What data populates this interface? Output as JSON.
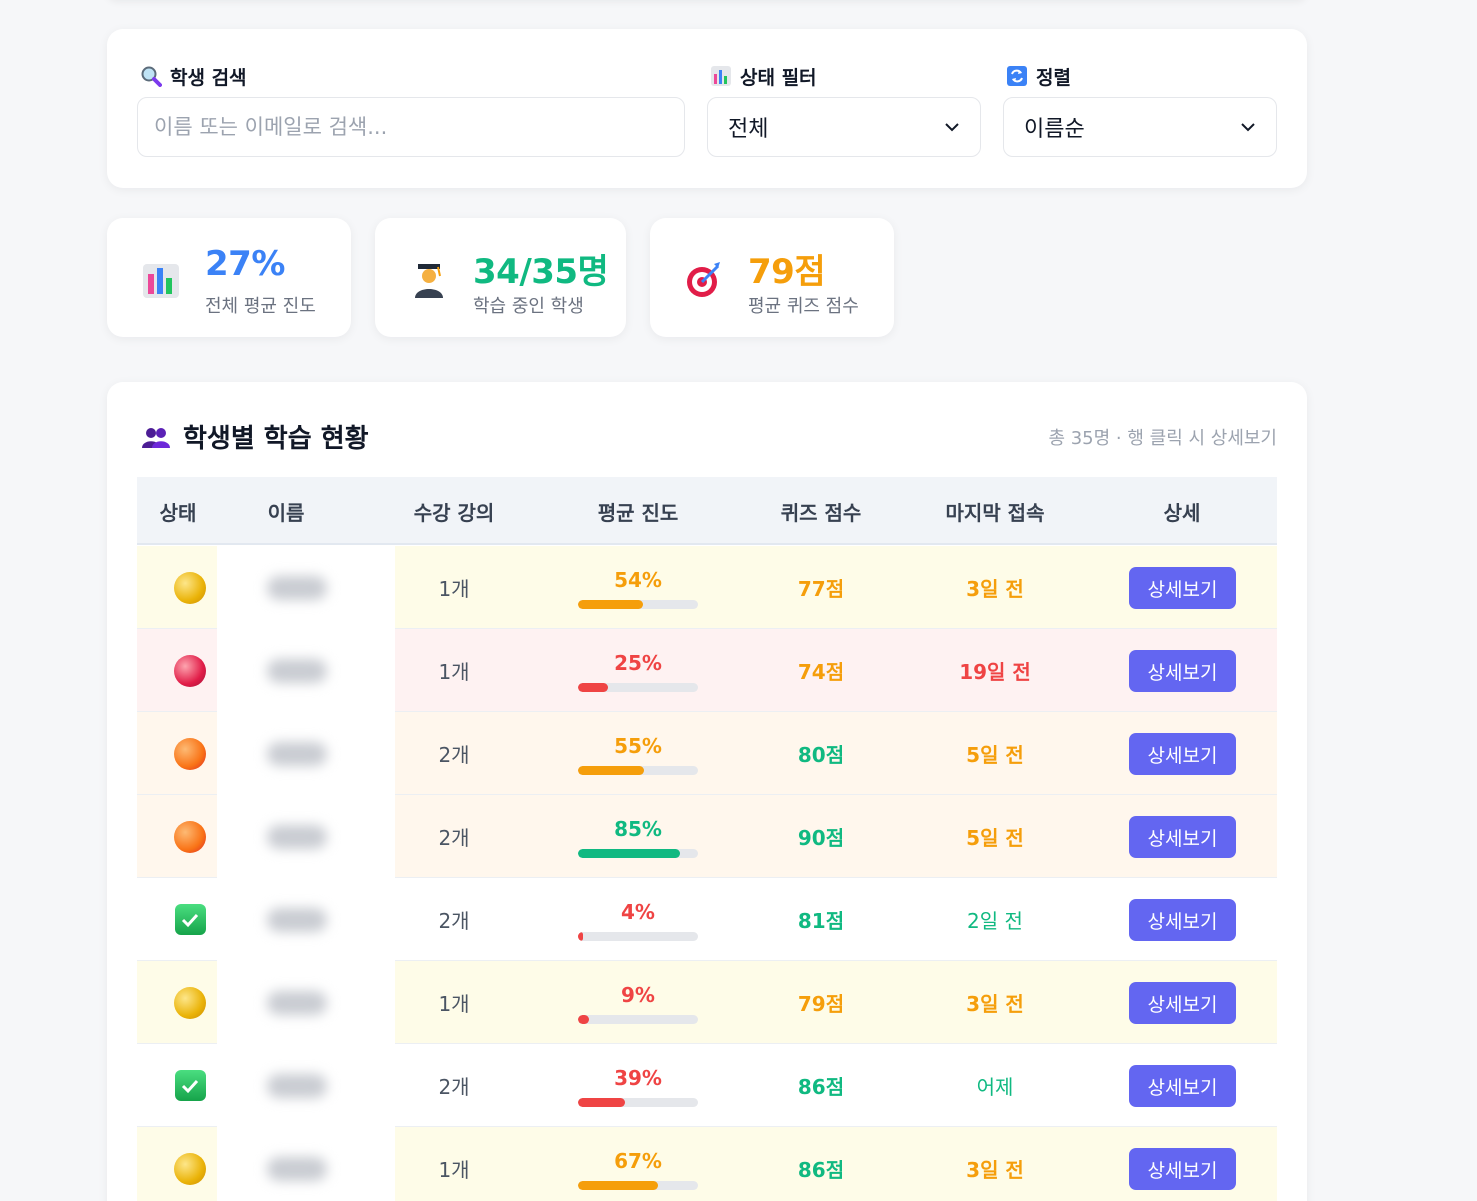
{
  "search": {
    "label": "학생 검색",
    "placeholder": "이름 또는 이메일로 검색..."
  },
  "status_filter": {
    "label": "상태 필터",
    "selected": "전체"
  },
  "sort": {
    "label": "정렬",
    "selected": "이름순"
  },
  "stats": [
    {
      "value": "27%",
      "label": "전체 평균 진도",
      "icon": "bar-chart-icon",
      "color": "#3b82f6"
    },
    {
      "value": "34/35명",
      "label": "학습 중인 학생",
      "icon": "student-icon",
      "color": "#10b981"
    },
    {
      "value": "79점",
      "label": "평균 퀴즈 점수",
      "icon": "target-icon",
      "color": "#f59e0b"
    }
  ],
  "table": {
    "title": "학생별 학습 현황",
    "meta": "총 35명 · 행 클릭 시 상세보기",
    "headers": [
      "상태",
      "이름",
      "수강 강의",
      "평균 진도",
      "퀴즈 점수",
      "마지막 접속",
      "상세"
    ],
    "button_label": "상세보기",
    "rows": [
      {
        "status": "yellow",
        "courses": "1개",
        "progress": 54,
        "progress_label": "54%",
        "score": "77점",
        "last": "3일 전",
        "bg": "#fefce8",
        "prog_color": "#f59e0b",
        "score_color": "#f59e0b",
        "last_color": "#f59e0b",
        "last_bold": true
      },
      {
        "status": "red",
        "courses": "1개",
        "progress": 25,
        "progress_label": "25%",
        "score": "74점",
        "last": "19일 전",
        "bg": "#fef2f2",
        "prog_color": "#ef4444",
        "score_color": "#f59e0b",
        "last_color": "#ef4444",
        "last_bold": true
      },
      {
        "status": "orange",
        "courses": "2개",
        "progress": 55,
        "progress_label": "55%",
        "score": "80점",
        "last": "5일 전",
        "bg": "#fff7ed",
        "prog_color": "#f59e0b",
        "score_color": "#10b981",
        "last_color": "#f59e0b",
        "last_bold": true
      },
      {
        "status": "orange",
        "courses": "2개",
        "progress": 85,
        "progress_label": "85%",
        "score": "90점",
        "last": "5일 전",
        "bg": "#fff7ed",
        "prog_color": "#10b981",
        "score_color": "#10b981",
        "last_color": "#f59e0b",
        "last_bold": true
      },
      {
        "status": "check",
        "courses": "2개",
        "progress": 4,
        "progress_label": "4%",
        "score": "81점",
        "last": "2일 전",
        "bg": "#ffffff",
        "prog_color": "#ef4444",
        "score_color": "#10b981",
        "last_color": "#10b981",
        "last_bold": false
      },
      {
        "status": "yellow",
        "courses": "1개",
        "progress": 9,
        "progress_label": "9%",
        "score": "79점",
        "last": "3일 전",
        "bg": "#fefce8",
        "prog_color": "#ef4444",
        "score_color": "#f59e0b",
        "last_color": "#f59e0b",
        "last_bold": true
      },
      {
        "status": "check",
        "courses": "2개",
        "progress": 39,
        "progress_label": "39%",
        "score": "86점",
        "last": "어제",
        "bg": "#ffffff",
        "prog_color": "#ef4444",
        "score_color": "#10b981",
        "last_color": "#10b981",
        "last_bold": false
      },
      {
        "status": "yellow",
        "courses": "1개",
        "progress": 67,
        "progress_label": "67%",
        "score": "86점",
        "last": "3일 전",
        "bg": "#fefce8",
        "prog_color": "#f59e0b",
        "score_color": "#10b981",
        "last_color": "#f59e0b",
        "last_bold": true
      }
    ]
  }
}
